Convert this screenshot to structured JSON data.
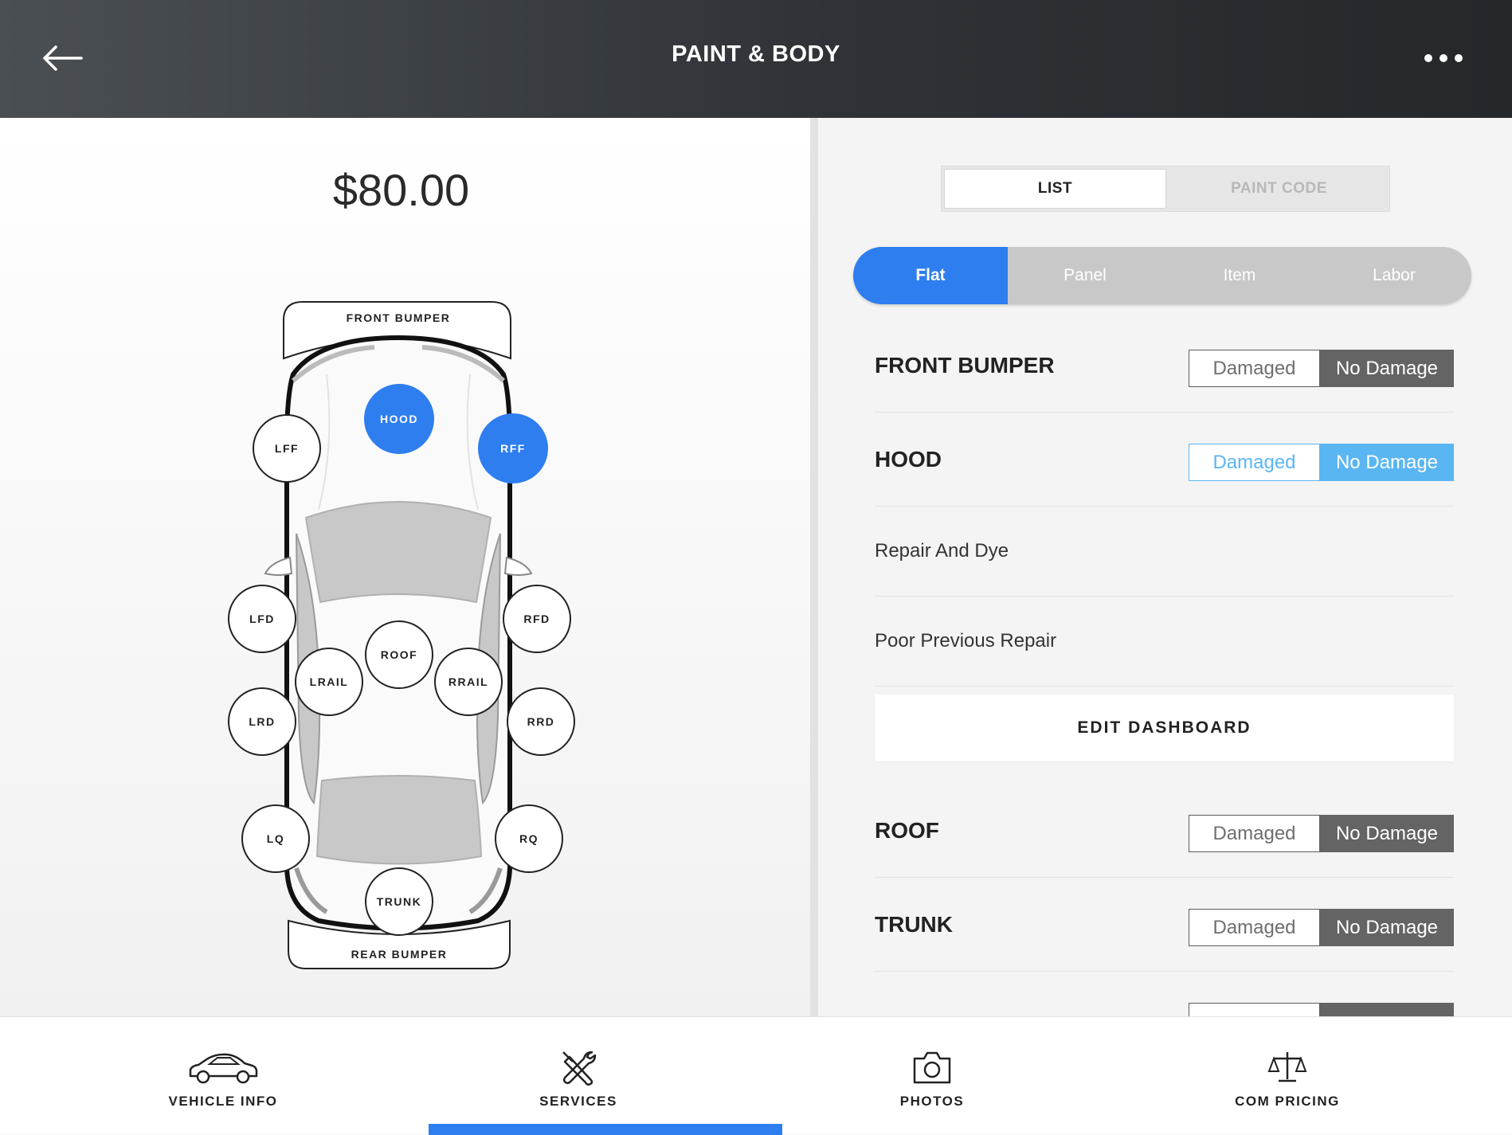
{
  "header": {
    "title": "PAINT & BODY"
  },
  "price": "$80.00",
  "car_diagram": {
    "front_bumper": "FRONT BUMPER",
    "rear_bumper": "REAR BUMPER",
    "hotspots": {
      "hood": "HOOD",
      "lff": "LFF",
      "rff": "RFF",
      "lfd": "LFD",
      "rfd": "RFD",
      "roof": "ROOF",
      "lrail": "LRAIL",
      "rrail": "RRAIL",
      "lrd": "LRD",
      "rrd": "RRD",
      "lq": "LQ",
      "rq": "RQ",
      "trunk": "TRUNK"
    },
    "selected": [
      "hood",
      "rff"
    ],
    "selected_color": "#2e7ef0"
  },
  "view_tabs": {
    "list": "LIST",
    "paint_code": "PAINT CODE",
    "active": "list"
  },
  "pricing_tabs": {
    "flat": "Flat",
    "panel": "Panel",
    "item": "Item",
    "labor": "Labor",
    "active": "flat"
  },
  "damage_rows": {
    "front_bumper": {
      "label": "FRONT BUMPER",
      "damaged": "Damaged",
      "no_damage": "No Damage"
    },
    "hood": {
      "label": "HOOD",
      "damaged": "Damaged",
      "no_damage": "No Damage"
    },
    "roof": {
      "label": "ROOF",
      "damaged": "Damaged",
      "no_damage": "No Damage"
    },
    "trunk": {
      "label": "TRUNK",
      "damaged": "Damaged",
      "no_damage": "No Damage"
    }
  },
  "hood_options": [
    "Repair And Dye",
    "Poor Previous Repair"
  ],
  "edit_dashboard": "EDIT DASHBOARD",
  "bottom_nav": {
    "vehicle_info": "VEHICLE INFO",
    "services": "SERVICES",
    "photos": "PHOTOS",
    "com_pricing": "COM PRICING",
    "active": "services"
  },
  "colors": {
    "accent": "#2e7ef0",
    "hood_toggle": "#5ab6f2",
    "header": "#2f3337"
  }
}
